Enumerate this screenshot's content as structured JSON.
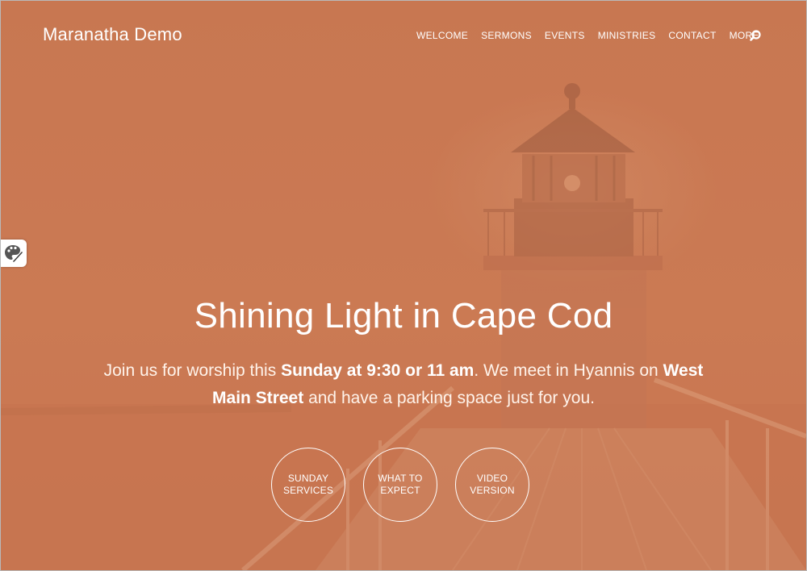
{
  "site": {
    "title": "Maranatha Demo"
  },
  "nav": {
    "items": [
      {
        "label": "WELCOME"
      },
      {
        "label": "SERMONS"
      },
      {
        "label": "EVENTS"
      },
      {
        "label": "MINISTRIES"
      },
      {
        "label": "CONTACT"
      },
      {
        "label": "MORE"
      }
    ],
    "search_icon": "search-icon"
  },
  "style_switcher": {
    "icon": "palette-brush-icon"
  },
  "hero": {
    "background_image": "lighthouse-pier-photo",
    "title": "Shining Light in Cape Cod",
    "text_1": "Join us for worship this ",
    "text_bold_1": "Sunday at 9:30 or 11 am",
    "text_2": ". We meet in Hyannis on ",
    "text_bold_2": "West Main Street",
    "text_3": " and have a parking space just for you."
  },
  "buttons": [
    {
      "line1": "SUNDAY",
      "line2": "SERVICES"
    },
    {
      "line1": "WHAT TO",
      "line2": "EXPECT"
    },
    {
      "line1": "VIDEO",
      "line2": "VERSION"
    }
  ],
  "colors": {
    "overlay": "#c9764f",
    "text": "#ffffff"
  }
}
